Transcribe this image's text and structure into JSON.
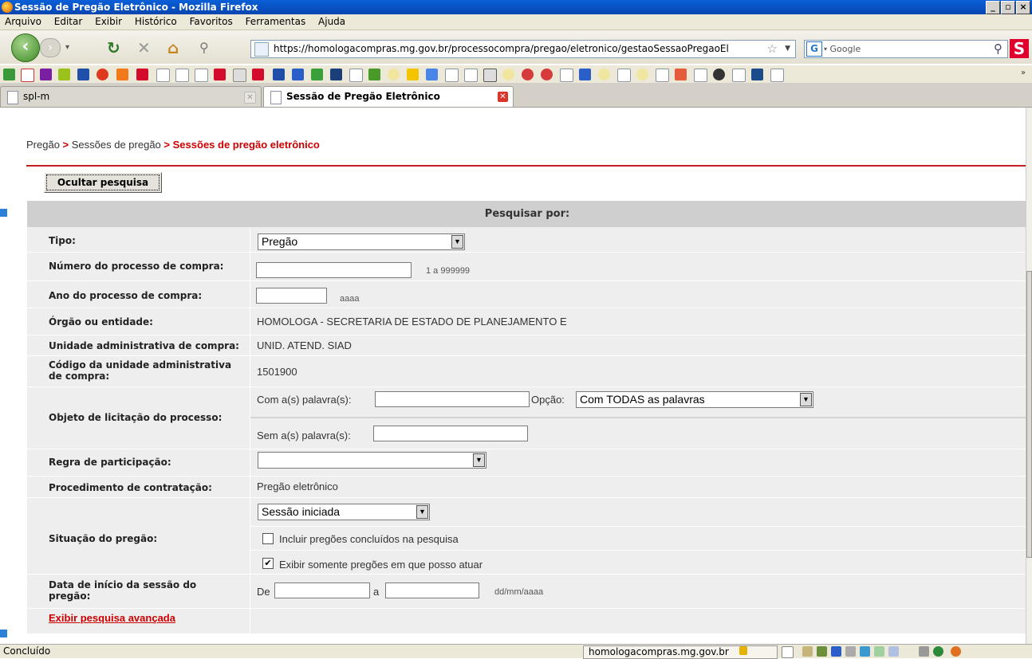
{
  "window": {
    "title": "Sessão de Pregão Eletrônico - Mozilla Firefox"
  },
  "menu": [
    "Arquivo",
    "Editar",
    "Exibir",
    "Histórico",
    "Favoritos",
    "Ferramentas",
    "Ajuda"
  ],
  "nav": {
    "url": "https://homologacompras.mg.gov.br/processocompra/pregao/eletronico/gestaoSessaoPregaoEl",
    "search_placeholder": "Google"
  },
  "tabs": [
    {
      "label": "spl-m"
    },
    {
      "label": "Sessão de Pregão Eletrônico"
    }
  ],
  "breadcrumb": {
    "item1": "Pregão",
    "sep": ">",
    "item2": "Sessões de pregão",
    "current": "Sessões de pregão eletrônico"
  },
  "buttons": {
    "hide_search": "Ocultar pesquisa"
  },
  "form": {
    "header": "Pesquisar por:",
    "tipo": {
      "label": "Tipo:",
      "value": "Pregão"
    },
    "numero": {
      "label": "Número do processo de compra:",
      "value": "",
      "hint": "1 a 999999"
    },
    "ano": {
      "label": "Ano do processo de compra:",
      "value": "",
      "hint": "aaaa"
    },
    "orgao": {
      "label": "Órgão ou entidade:",
      "value": "HOMOLOGA - SECRETARIA DE ESTADO DE PLANEJAMENTO E"
    },
    "unidade": {
      "label": "Unidade administrativa de compra:",
      "value": "UNID. ATEND. SIAD"
    },
    "codigo": {
      "label1": "Código da unidade administrativa",
      "label2": "de compra:",
      "value": "1501900"
    },
    "objeto": {
      "label": "Objeto de licitação do processo:",
      "com_label": "Com a(s) palavra(s):",
      "opcao_label": "Opção:",
      "opcao_value": "Com TODAS as palavras",
      "sem_label": "Sem a(s) palavra(s):"
    },
    "regra": {
      "label": "Regra de participação:",
      "value": ""
    },
    "procedimento": {
      "label": "Procedimento de contratação:",
      "value": "Pregão eletrônico"
    },
    "situacao": {
      "label": "Situação do pregão:",
      "value": "Sessão iniciada",
      "check1": "Incluir pregões concluídos na pesquisa",
      "check1_checked": false,
      "check2": "Exibir somente pregões em que posso atuar",
      "check2_checked": true,
      "check2_mark": "✔"
    },
    "data": {
      "label1": "Data de início da sessão do",
      "label2": "pregão:",
      "de": "De",
      "a": "a",
      "hint": "dd/mm/aaaa"
    },
    "advanced_link": "Exibir pesquisa avançada"
  },
  "status": {
    "text": "Concluído",
    "host": "homologacompras.mg.gov.br"
  }
}
